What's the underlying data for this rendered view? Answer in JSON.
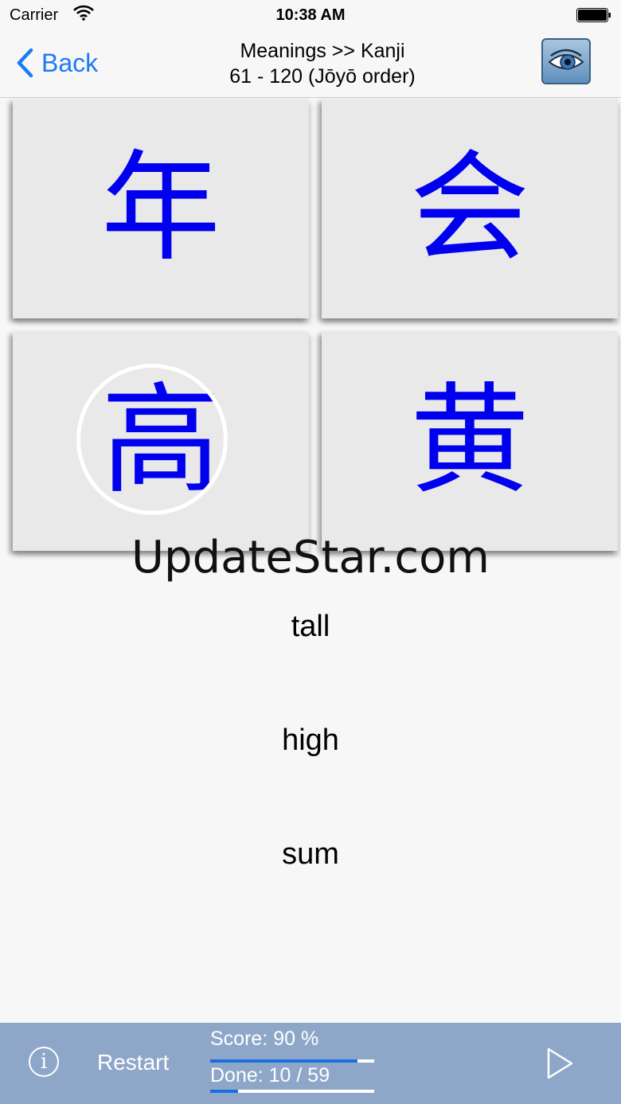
{
  "status": {
    "carrier": "Carrier",
    "time": "10:38 AM"
  },
  "nav": {
    "back_label": "Back",
    "title_line1": "Meanings >> Kanji",
    "title_line2": "61 - 120 (Jōyō order)"
  },
  "tiles": [
    "年",
    "会",
    "高",
    "黄"
  ],
  "selected_tile": 2,
  "watermark": "UpdateStar.com",
  "meanings": [
    "tall",
    "high",
    "sum"
  ],
  "bottom": {
    "restart_label": "Restart",
    "score_text": "Score:  90 %",
    "score_fraction": 0.9,
    "done_text": "Done:  10 / 59",
    "done_fraction": 0.169
  },
  "colors": {
    "kanji": "#0000ee",
    "accent": "#1a7bf6",
    "bottom_bar": "#8ea7c9",
    "progress": "#1a6fe0"
  },
  "icons": [
    "wifi-icon",
    "battery-icon",
    "back-chevron-icon",
    "eye-icon",
    "info-icon",
    "play-icon"
  ]
}
